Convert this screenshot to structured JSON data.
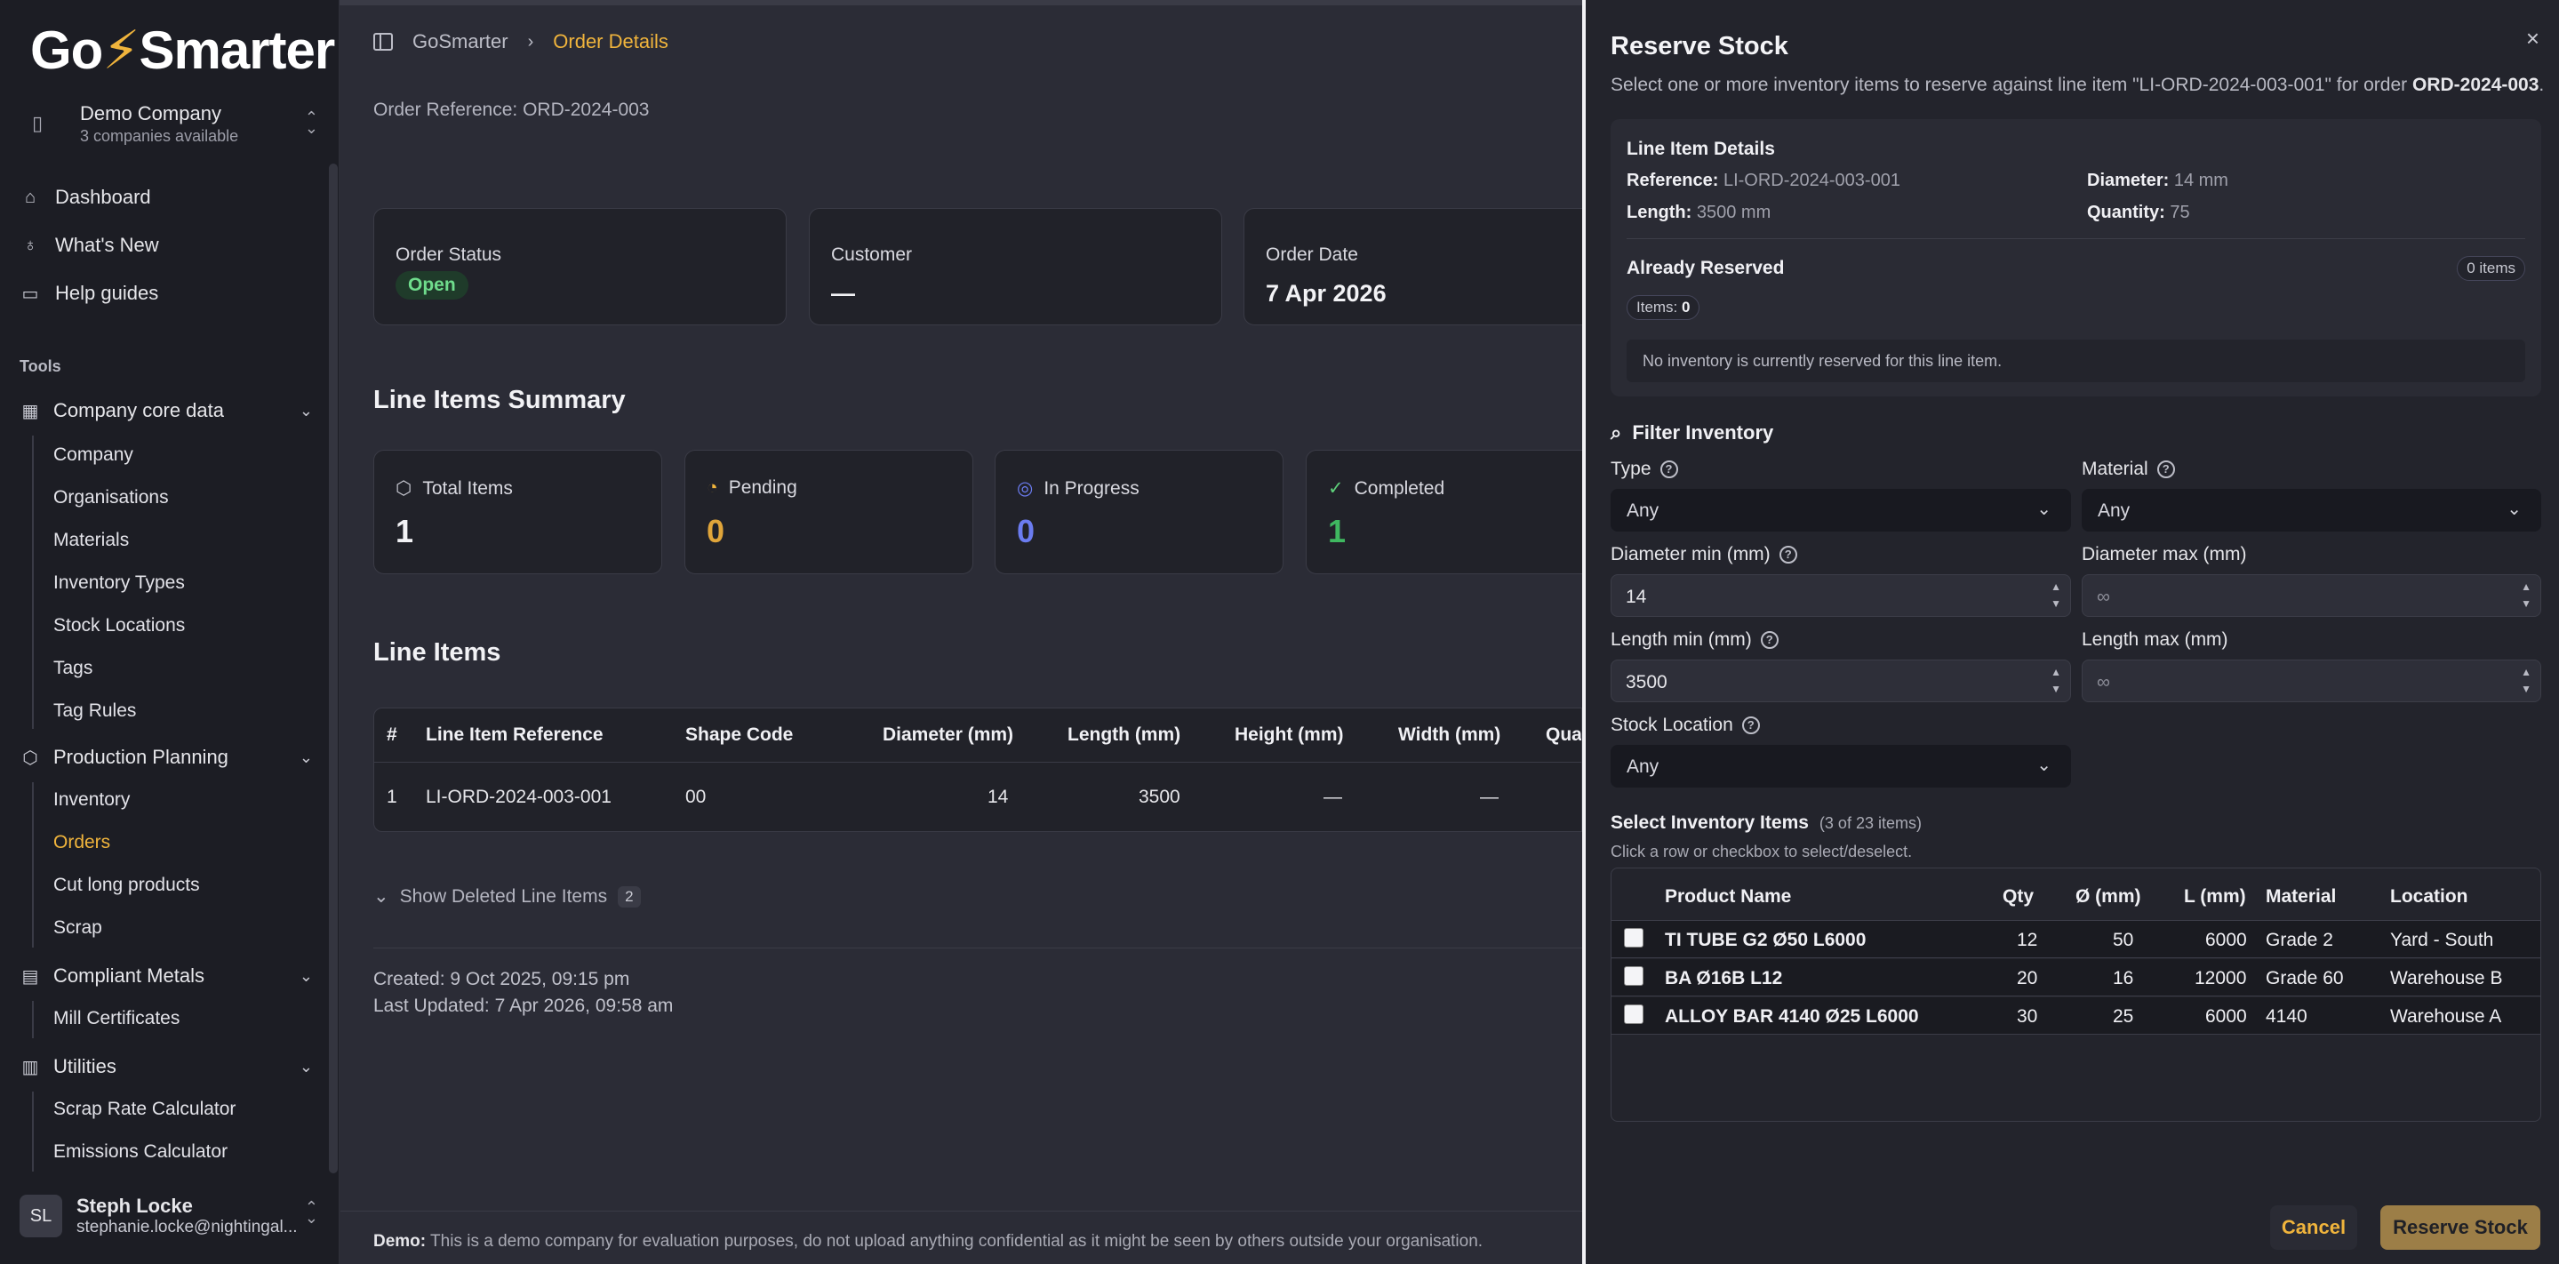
{
  "brand": {
    "name_prefix": "Go",
    "name_bolt": "⚡",
    "name_suffix": "Smarter",
    "accent": "#f0b43c"
  },
  "company": {
    "name": "Demo Company",
    "sub": "3 companies available"
  },
  "nav": {
    "dashboard": "Dashboard",
    "whats_new": "What's New",
    "help": "Help guides"
  },
  "tools_label": "Tools",
  "groups": {
    "core": {
      "label": "Company core data",
      "items": [
        "Company",
        "Organisations",
        "Materials",
        "Inventory Types",
        "Stock Locations",
        "Tags",
        "Tag Rules"
      ]
    },
    "production": {
      "label": "Production Planning",
      "items": [
        "Inventory",
        "Orders",
        "Cut long products",
        "Scrap"
      ]
    },
    "compliant": {
      "label": "Compliant Metals",
      "items": [
        "Mill Certificates"
      ]
    },
    "utilities": {
      "label": "Utilities",
      "items": [
        "Scrap Rate Calculator",
        "Emissions Calculator"
      ]
    }
  },
  "user": {
    "initials": "SL",
    "name": "Steph Locke",
    "email": "stephanie.locke@nightingal..."
  },
  "breadcrumb": {
    "root": "GoSmarter",
    "current": "Order Details"
  },
  "order": {
    "reference": "Order Reference: ORD-2024-003",
    "status_label": "Order Status",
    "status": "Open",
    "customer_label": "Customer",
    "customer": "—",
    "date_label": "Order Date",
    "date": "7 Apr 2026"
  },
  "summary": {
    "title": "Line Items Summary",
    "total_label": "Total Items",
    "total": "1",
    "pending_label": "Pending",
    "pending": "0",
    "progress_label": "In Progress",
    "progress": "0",
    "completed_label": "Completed",
    "completed": "1"
  },
  "line_items": {
    "title": "Line Items",
    "headers": [
      "#",
      "Line Item Reference",
      "Shape Code",
      "Diameter (mm)",
      "Length (mm)",
      "Height (mm)",
      "Width (mm)",
      "Qua"
    ],
    "row": [
      "1",
      "LI-ORD-2024-003-001",
      "00",
      "14",
      "3500",
      "—",
      "—"
    ]
  },
  "deleted": {
    "label": "Show Deleted Line Items",
    "count": "2"
  },
  "meta": {
    "created": "Created: 9 Oct 2025, 09:15 pm",
    "updated": "Last Updated: 7 Apr 2026, 09:58 am"
  },
  "footer": {
    "bold": "Demo:",
    "text": " This is a demo company for evaluation purposes, do not upload anything confidential as it might be seen by others outside your organisation."
  },
  "panel": {
    "title": "Reserve Stock",
    "desc_pre": "Select one or more inventory items to reserve against line item \"LI-ORD-2024-003-001\" for order ",
    "desc_order": "ORD-2024-003",
    "desc_post": ".",
    "details": {
      "title": "Line Item Details",
      "ref_label": "Reference:",
      "ref": " LI-ORD-2024-003-001",
      "dia_label": "Diameter:",
      "dia": " 14 mm",
      "len_label": "Length:",
      "len": " 3500 mm",
      "qty_label": "Quantity:",
      "qty": " 75",
      "reserved_title": "Already Reserved",
      "reserved_count": "0 items",
      "items_label": "Items: ",
      "items_val": "0",
      "none_msg": "No inventory is currently reserved for this line item."
    },
    "filter": {
      "title": "Filter Inventory",
      "type_label": "Type",
      "type_val": "Any",
      "material_label": "Material",
      "material_val": "Any",
      "dmin_label": "Diameter min (mm)",
      "dmin_val": "14",
      "dmax_label": "Diameter max (mm)",
      "dmax_val": "∞",
      "lmin_label": "Length min (mm)",
      "lmin_val": "3500",
      "lmax_label": "Length max (mm)",
      "lmax_val": "∞",
      "loc_label": "Stock Location",
      "loc_val": "Any"
    },
    "select": {
      "title": "Select Inventory Items",
      "count": "(3 of 23 items)",
      "hint": "Click a row or checkbox to select/deselect.",
      "headers": [
        "Product Name",
        "Qty",
        "Ø (mm)",
        "L (mm)",
        "Material",
        "Location"
      ],
      "rows": [
        [
          "TI TUBE G2 Ø50 L6000",
          "12",
          "50",
          "6000",
          "Grade 2",
          "Yard - South"
        ],
        [
          "BA Ø16B L12",
          "20",
          "16",
          "12000",
          "Grade 60",
          "Warehouse B"
        ],
        [
          "ALLOY BAR 4140 Ø25 L6000",
          "30",
          "25",
          "6000",
          "4140",
          "Warehouse A"
        ]
      ]
    },
    "cancel": "Cancel",
    "reserve": "Reserve Stock",
    "close": "×"
  }
}
